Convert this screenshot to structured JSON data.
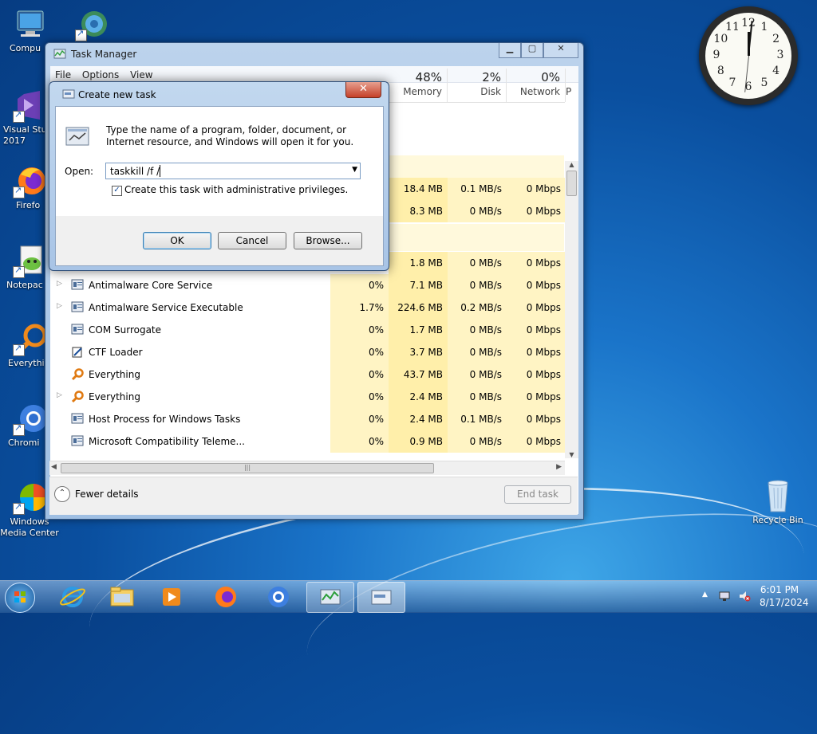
{
  "desktop_icons": [
    {
      "label": "Compu",
      "icon": "computer-icon"
    },
    {
      "label": "",
      "icon": "network-icon"
    },
    {
      "label": "Visual Stu\n2017",
      "icon": "visual-studio-icon"
    },
    {
      "label": "Firefo",
      "icon": "firefox-icon"
    },
    {
      "label": "Notepac",
      "icon": "notepad-plus-icon"
    },
    {
      "label": "Everythi",
      "icon": "everything-icon"
    },
    {
      "label": "Chromi",
      "icon": "chromium-icon"
    },
    {
      "label": "Windows\nMedia Center",
      "icon": "media-center-icon"
    },
    {
      "label": "Recycle Bin",
      "icon": "recycle-bin-icon"
    }
  ],
  "task_manager": {
    "title": "Task Manager",
    "menu": [
      "File",
      "Options",
      "View"
    ],
    "columns": [
      {
        "pct": "48%",
        "name": "Memory"
      },
      {
        "pct": "2%",
        "name": "Disk"
      },
      {
        "pct": "0%",
        "name": "Network"
      },
      {
        "pct": "",
        "name": "P"
      }
    ],
    "partial_rows": [
      {
        "mem": "18.4 MB",
        "disk": "0.1 MB/s",
        "net": "0 Mbps"
      },
      {
        "mem": "8.3 MB",
        "disk": "0 MB/s",
        "net": "0 Mbps"
      },
      {
        "mem": "1.8 MB",
        "disk": "0 MB/s",
        "net": "0 Mbps"
      }
    ],
    "rows": [
      {
        "name": "Antimalware Core Service",
        "expand": true,
        "icon": "service-icon",
        "cpu": "0%",
        "mem": "7.1 MB",
        "disk": "0 MB/s",
        "net": "0 Mbps"
      },
      {
        "name": "Antimalware Service Executable",
        "expand": true,
        "icon": "service-icon",
        "cpu": "1.7%",
        "mem": "224.6 MB",
        "disk": "0.2 MB/s",
        "net": "0 Mbps"
      },
      {
        "name": "COM Surrogate",
        "expand": false,
        "icon": "service-icon",
        "cpu": "0%",
        "mem": "1.7 MB",
        "disk": "0 MB/s",
        "net": "0 Mbps"
      },
      {
        "name": "CTF Loader",
        "expand": false,
        "icon": "ctf-icon",
        "cpu": "0%",
        "mem": "3.7 MB",
        "disk": "0 MB/s",
        "net": "0 Mbps"
      },
      {
        "name": "Everything",
        "expand": false,
        "icon": "magnifier-icon",
        "cpu": "0%",
        "mem": "43.7 MB",
        "disk": "0 MB/s",
        "net": "0 Mbps"
      },
      {
        "name": "Everything",
        "expand": true,
        "icon": "magnifier-icon",
        "cpu": "0%",
        "mem": "2.4 MB",
        "disk": "0 MB/s",
        "net": "0 Mbps"
      },
      {
        "name": "Host Process for Windows Tasks",
        "expand": false,
        "icon": "service-icon",
        "cpu": "0%",
        "mem": "2.4 MB",
        "disk": "0.1 MB/s",
        "net": "0 Mbps"
      },
      {
        "name": "Microsoft Compatibility Teleme...",
        "expand": false,
        "icon": "service-icon",
        "cpu": "0%",
        "mem": "0.9 MB",
        "disk": "0 MB/s",
        "net": "0 Mbps"
      }
    ],
    "fewer_details": "Fewer details",
    "end_task": "End task"
  },
  "dialog": {
    "title": "Create new task",
    "description": "Type the name of a program, folder, document, or Internet resource, and Windows will open it for you.",
    "open_label": "Open:",
    "open_value": "taskkill /f /",
    "admin_checkbox": "Create this task with administrative privileges.",
    "admin_checked": true,
    "ok": "OK",
    "cancel": "Cancel",
    "browse": "Browse..."
  },
  "clock_numbers": [
    "12",
    "1",
    "2",
    "3",
    "4",
    "5",
    "6",
    "7",
    "8",
    "9",
    "10",
    "11"
  ],
  "taskbar": {
    "time": "6:01 PM",
    "date": "8/17/2024"
  }
}
